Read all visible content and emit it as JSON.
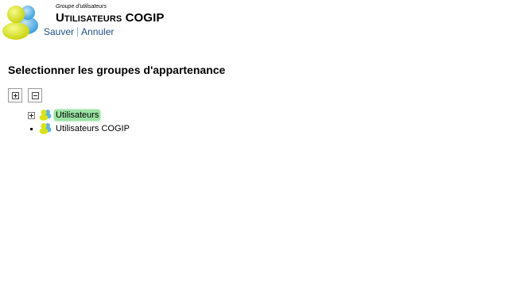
{
  "header": {
    "subtitle": "Groupe d'utilisateurs",
    "title": "Utilisateurs COGIP",
    "actions": {
      "save": "Sauver",
      "cancel": "Annuler"
    }
  },
  "section": {
    "title": "Selectionner les groupes d'appartenance"
  },
  "toolbar": {
    "expand_all_icon": "plus-box-icon",
    "collapse_all_icon": "minus-box-icon"
  },
  "tree": {
    "nodes": [
      {
        "label": "Utilisateurs",
        "expandable": true,
        "selected": true,
        "icon": "user-group-icon"
      },
      {
        "label": "Utilisateurs COGIP",
        "expandable": false,
        "selected": false,
        "icon": "user-group-icon"
      }
    ]
  },
  "colors": {
    "link": "#1f4f86",
    "selection": "#9be3a4",
    "logo_yellow": "#d8e21a",
    "logo_blue": "#5fb3e6"
  }
}
